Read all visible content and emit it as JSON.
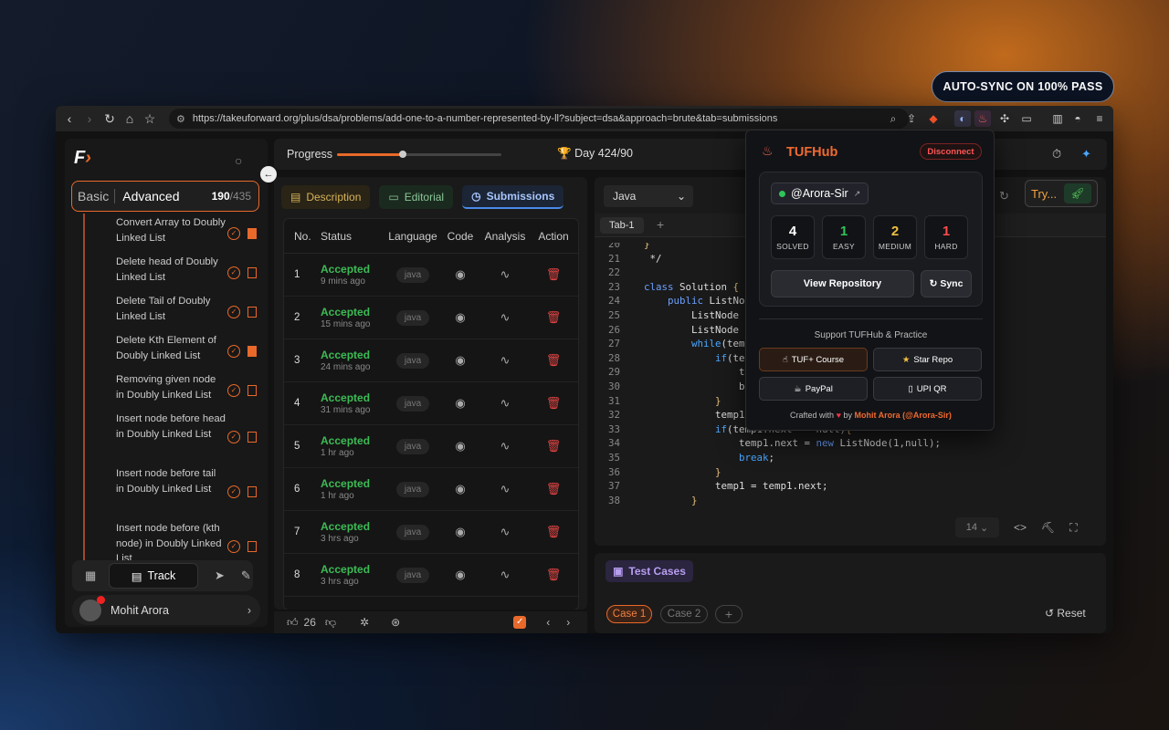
{
  "banner": "AUTO-SYNC ON 100% PASS",
  "browser": {
    "url": "https://takeuforward.org/plus/dsa/problems/add-one-to-a-number-represented-by-ll?subject=dsa&approach=brute&tab=submissions"
  },
  "sidebar": {
    "toggle": {
      "basic": "Basic",
      "advanced": "Advanced",
      "count": "190",
      "total": "/435"
    },
    "problems": [
      {
        "title": "Convert Array to Doubly Linked List",
        "bookmarked": true
      },
      {
        "title": "Delete head of Doubly Linked List",
        "bookmarked": false
      },
      {
        "title": "Delete Tail of Doubly Linked List",
        "bookmarked": false
      },
      {
        "title": "Delete Kth Element of Doubly Linked List",
        "bookmarked": true
      },
      {
        "title": "Removing given node in Doubly Linked List",
        "bookmarked": false
      },
      {
        "title": "Insert node before head in Doubly Linked List",
        "bookmarked": false
      },
      {
        "title": "Insert node before tail in Doubly Linked List",
        "bookmarked": false
      },
      {
        "title": "Insert node before (kth node) in Doubly Linked List",
        "bookmarked": false
      }
    ],
    "track_label": "Track",
    "user": "Mohit Arora"
  },
  "topbar": {
    "progress_label": "Progress",
    "progress_fraction": 0.4,
    "day": "Day 424/90"
  },
  "tabs": {
    "description": "Description",
    "editorial": "Editorial",
    "submissions": "Submissions"
  },
  "table": {
    "headers": [
      "No.",
      "Status",
      "Language",
      "Code",
      "Analysis",
      "Action"
    ],
    "rows": [
      {
        "no": "1",
        "status": "Accepted",
        "ago": "9 mins ago",
        "lang": "java"
      },
      {
        "no": "2",
        "status": "Accepted",
        "ago": "15 mins ago",
        "lang": "java"
      },
      {
        "no": "3",
        "status": "Accepted",
        "ago": "24 mins ago",
        "lang": "java"
      },
      {
        "no": "4",
        "status": "Accepted",
        "ago": "31 mins ago",
        "lang": "java"
      },
      {
        "no": "5",
        "status": "Accepted",
        "ago": "1 hr ago",
        "lang": "java"
      },
      {
        "no": "6",
        "status": "Accepted",
        "ago": "1 hr ago",
        "lang": "java"
      },
      {
        "no": "7",
        "status": "Accepted",
        "ago": "3 hrs ago",
        "lang": "java"
      },
      {
        "no": "8",
        "status": "Accepted",
        "ago": "3 hrs ago",
        "lang": "java"
      }
    ]
  },
  "footer": {
    "likes": "26"
  },
  "editor": {
    "language": "Java",
    "try_label": "Try...",
    "tab": "Tab-1",
    "font_size": "14",
    "lines": [
      {
        "n": "20",
        "t": "}"
      },
      {
        "n": "21",
        "t": " */"
      },
      {
        "n": "22",
        "t": ""
      },
      {
        "n": "23",
        "t": "class Solution {"
      },
      {
        "n": "24",
        "t": "    public ListNode"
      },
      {
        "n": "25",
        "t": "        ListNode t"
      },
      {
        "n": "26",
        "t": "        ListNode t"
      },
      {
        "n": "27",
        "t": "        while(temp"
      },
      {
        "n": "28",
        "t": "            if(tem"
      },
      {
        "n": "29",
        "t": "                te"
      },
      {
        "n": "30",
        "t": "                br"
      },
      {
        "n": "31",
        "t": "            }"
      },
      {
        "n": "32",
        "t": "            temp1."
      },
      {
        "n": "33",
        "t": "            if(temp1.next == null){"
      },
      {
        "n": "34",
        "t": "                temp1.next = new ListNode(1,null);"
      },
      {
        "n": "35",
        "t": "                break;"
      },
      {
        "n": "36",
        "t": "            }"
      },
      {
        "n": "37",
        "t": "            temp1 = temp1.next;"
      },
      {
        "n": "38",
        "t": "        }"
      }
    ]
  },
  "testcases": {
    "label": "Test Cases",
    "case1": "Case 1",
    "case2": "Case 2",
    "add": "+",
    "reset": "Reset"
  },
  "popup": {
    "title": "TUFHub",
    "disconnect": "Disconnect",
    "handle": "@Arora-Sir",
    "stats": [
      {
        "n": "4",
        "l": "SOLVED",
        "c": "#ffffff"
      },
      {
        "n": "1",
        "l": "EASY",
        "c": "#2ec45a"
      },
      {
        "n": "2",
        "l": "MEDIUM",
        "c": "#f0c040"
      },
      {
        "n": "1",
        "l": "HARD",
        "c": "#ff4a4a"
      }
    ],
    "view_repo": "View Repository",
    "sync": "Sync",
    "support": "Support TUFHub & Practice",
    "buttons": {
      "course": "TUF+ Course",
      "star": "Star Repo",
      "paypal": "PayPal",
      "upi": "UPI QR"
    },
    "crafted": "Crafted with",
    "by": "by",
    "author": "Mohit Arora (@Arora-Sir)"
  }
}
